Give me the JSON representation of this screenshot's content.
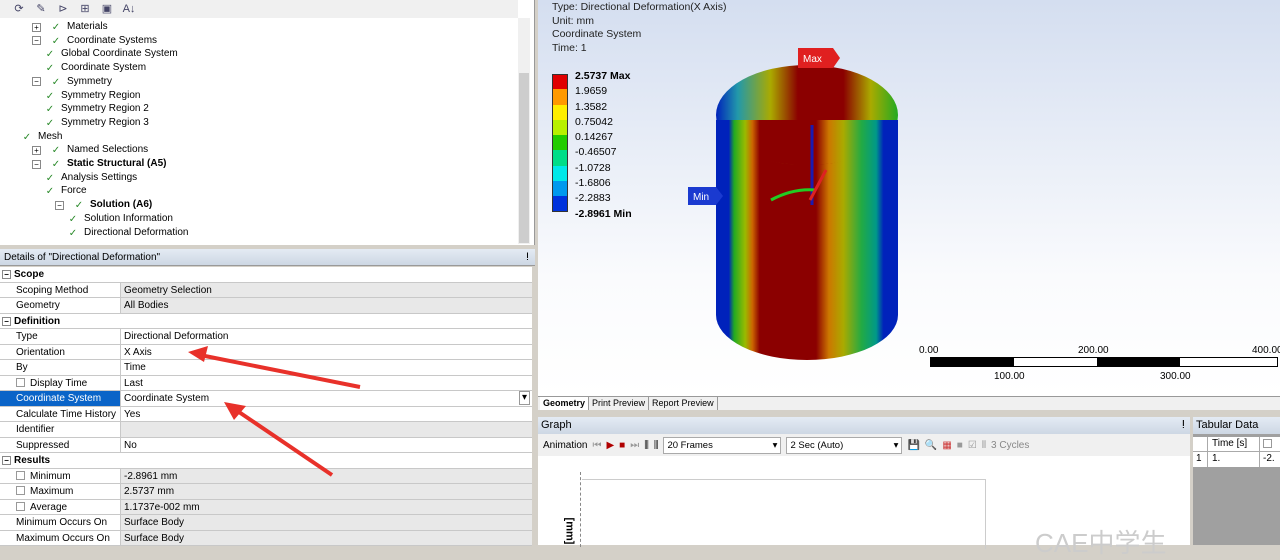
{
  "tree": {
    "items": [
      {
        "label": "Materials",
        "bold": false,
        "indent": 0,
        "pm": "+",
        "icon": "materials-icon"
      },
      {
        "label": "Coordinate Systems",
        "bold": false,
        "indent": 0,
        "pm": "-",
        "icon": "coordinate-systems-icon"
      },
      {
        "label": "Global Coordinate System",
        "bold": false,
        "indent": 1,
        "pm": "",
        "icon": "coordinate-system-icon"
      },
      {
        "label": "Coordinate System",
        "bold": false,
        "indent": 1,
        "pm": "",
        "icon": "coordinate-system-icon"
      },
      {
        "label": "Symmetry",
        "bold": false,
        "indent": 0,
        "pm": "-",
        "icon": "symmetry-icon"
      },
      {
        "label": "Symmetry Region",
        "bold": false,
        "indent": 1,
        "pm": "",
        "icon": "symmetry-region-icon"
      },
      {
        "label": "Symmetry Region 2",
        "bold": false,
        "indent": 1,
        "pm": "",
        "icon": "symmetry-region-icon"
      },
      {
        "label": "Symmetry Region 3",
        "bold": false,
        "indent": 1,
        "pm": "",
        "icon": "symmetry-region-icon"
      },
      {
        "label": "Mesh",
        "bold": false,
        "indent": 0,
        "pm": "",
        "icon": "mesh-icon"
      },
      {
        "label": "Named Selections",
        "bold": false,
        "indent": 0,
        "pm": "+",
        "icon": "named-selections-icon"
      },
      {
        "label": "Static Structural (A5)",
        "bold": true,
        "indent": 0,
        "pm": "-",
        "icon": "static-structural-icon"
      },
      {
        "label": "Analysis Settings",
        "bold": false,
        "indent": 1,
        "pm": "",
        "icon": "analysis-settings-icon"
      },
      {
        "label": "Force",
        "bold": false,
        "indent": 1,
        "pm": "",
        "icon": "force-icon"
      },
      {
        "label": "Solution (A6)",
        "bold": true,
        "indent": 1,
        "pm": "-",
        "icon": "solution-icon"
      },
      {
        "label": "Solution Information",
        "bold": false,
        "indent": 2,
        "pm": "",
        "icon": "solution-information-icon"
      },
      {
        "label": "Directional Deformation",
        "bold": false,
        "indent": 2,
        "pm": "",
        "icon": "directional-deformation-icon"
      }
    ]
  },
  "details": {
    "title": "Details of \"Directional Deformation\"",
    "rows": [
      {
        "type": "sec",
        "k": "Scope"
      },
      {
        "k": "Scoping Method",
        "v": "Geometry Selection"
      },
      {
        "k": "Geometry",
        "v": "All Bodies"
      },
      {
        "type": "sec",
        "k": "Definition"
      },
      {
        "k": "Type",
        "v": "Directional Deformation",
        "w": true
      },
      {
        "k": "Orientation",
        "v": "X Axis",
        "w": true
      },
      {
        "k": "By",
        "v": "Time",
        "w": true
      },
      {
        "k": "Display Time",
        "v": "Last",
        "w": true,
        "cb": true
      },
      {
        "k": "Coordinate System",
        "v": "Coordinate System",
        "w": true,
        "sel": true
      },
      {
        "k": "Calculate Time History",
        "v": "Yes",
        "w": true
      },
      {
        "k": "Identifier",
        "v": ""
      },
      {
        "k": "Suppressed",
        "v": "No",
        "w": true
      },
      {
        "type": "sec",
        "k": "Results"
      },
      {
        "k": "Minimum",
        "v": "-2.8961 mm",
        "cb": true
      },
      {
        "k": "Maximum",
        "v": "2.5737 mm",
        "cb": true
      },
      {
        "k": "Average",
        "v": "1.1737e-002 mm",
        "cb": true
      },
      {
        "k": "Minimum Occurs On",
        "v": "Surface Body"
      },
      {
        "k": "Maximum Occurs On",
        "v": "Surface Body"
      }
    ]
  },
  "viewport": {
    "type": "Type: Directional Deformation(X Axis)",
    "unit": "Unit: mm",
    "cs": "Coordinate System",
    "time": "Time: 1",
    "max_tag": "Max",
    "min_tag": "Min",
    "legend": [
      {
        "t": "2.5737 Max",
        "c": "#e00000",
        "b": true
      },
      {
        "t": "1.9659",
        "c": "#ff9900"
      },
      {
        "t": "1.3582",
        "c": "#ffee00"
      },
      {
        "t": "0.75042",
        "c": "#b8f000"
      },
      {
        "t": "0.14267",
        "c": "#22cc00"
      },
      {
        "t": "-0.46507",
        "c": "#00dd88"
      },
      {
        "t": "-1.0728",
        "c": "#00e8e8"
      },
      {
        "t": "-1.6806",
        "c": "#0099ee"
      },
      {
        "t": "-2.2883",
        "c": "#0033dd"
      },
      {
        "t": "-2.8961 Min",
        "c": "",
        "b": true
      }
    ],
    "scale": {
      "top": [
        "0.00",
        "200.00",
        "400.00"
      ],
      "bottom": [
        "100.00",
        "300.00"
      ]
    }
  },
  "tabs": [
    "Geometry",
    "Print Preview",
    "Report Preview"
  ],
  "graph": {
    "title": "Graph",
    "animation": "Animation",
    "frames": "20 Frames",
    "duration": "2 Sec (Auto)",
    "cycles": "3 Cycles",
    "yaxis": "[mm]"
  },
  "tabular": {
    "title": "Tabular Data",
    "headers": [
      "Time [s]"
    ],
    "rows": [
      [
        "1",
        "1.",
        "-2."
      ]
    ]
  },
  "watermark": "CAE中学生"
}
